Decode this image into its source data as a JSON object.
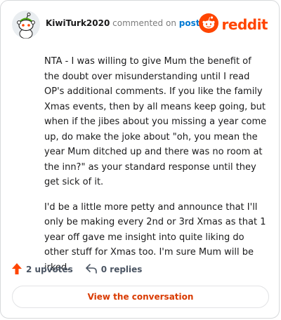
{
  "header": {
    "username": "KiwiTurk2020",
    "action_text": "commented on",
    "link_text": "post",
    "brand": "reddit",
    "avatar_icon": "snoo-avatar-icon",
    "brand_icon": "reddit-logo-icon"
  },
  "comment": {
    "paragraphs": [
      "NTA - I was willing to give Mum the benefit of the doubt over misunderstanding until I read OP's additional comments. If you like the family Xmas events, then by all means keep going, but when if the jibes about you missing a year come up, do make the joke about \"oh, you mean the year Mum ditched up and there was no room at the inn?\" as your standard response until they get sick of it.",
      "I'd be a little more petty and announce that I'll only be making every 2nd or 3rd Xmas as that 1 year off gave me insight into quite liking do other stuff for Xmas too. I'm sure Mum will be irked."
    ]
  },
  "actions": {
    "upvotes": "2 upvotes",
    "replies": "0 replies",
    "upvote_icon": "upvote-arrow-icon",
    "reply_icon": "reply-arrow-icon"
  },
  "cta": {
    "label": "View the conversation"
  },
  "colors": {
    "brand_orange": "#ff4500",
    "link_blue": "#0079d3",
    "cta_text": "#d93a00"
  }
}
